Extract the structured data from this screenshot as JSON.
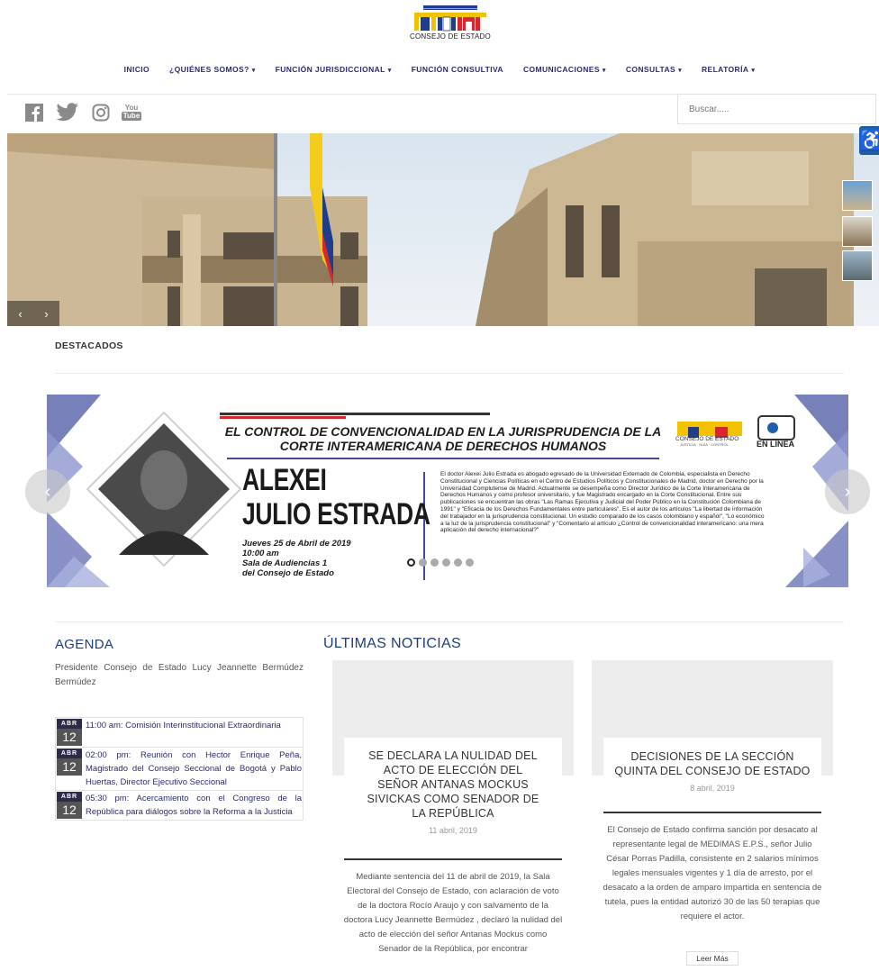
{
  "header": {
    "logo_text": "CONSEJO DE ESTADO",
    "nav": [
      {
        "label": "INICIO",
        "dropdown": false
      },
      {
        "label": "¿QUIÉNES SOMOS?",
        "dropdown": true
      },
      {
        "label": "FUNCIÓN JURISDICCIONAL",
        "dropdown": true
      },
      {
        "label": "FUNCIÓN CONSULTIVA",
        "dropdown": false
      },
      {
        "label": "COMUNICACIONES",
        "dropdown": true
      },
      {
        "label": "CONSULTAS",
        "dropdown": true
      },
      {
        "label": "RELATORÍA",
        "dropdown": true
      }
    ],
    "search_placeholder": "Buscar.....",
    "social": [
      "facebook-icon",
      "twitter-icon",
      "instagram-icon",
      "youtube-icon"
    ],
    "youtube_text_top": "You",
    "youtube_text_bottom": "Tube"
  },
  "hero": {
    "prev": "‹",
    "next": "›"
  },
  "destacados": {
    "heading": "DESTACADOS",
    "banner": {
      "title_line1": "EL CONTROL DE CONVENCIONALIDAD EN LA JURISPRUDENCIA DE LA",
      "title_line2": "CORTE INTERAMERICANA DE DERECHOS HUMANOS",
      "name_line1": "ALEXEI",
      "name_line2": "JULIO ESTRADA",
      "date": "Jueves 25 de Abril de 2019",
      "time": "10:00 am",
      "place1": "Sala de Audiencias 1",
      "place2": "del Consejo de Estado",
      "logo_caption": "CONSEJO DE ESTADO",
      "logo_sub": "JUSTICIA · GUÍA · CONTROL",
      "online": "EN LÍNEA",
      "bio": "El doctor Alexei Julio Estrada es abogado egresado de la Universidad Externado de Colombia, especialista en Derecho Constitucional y Ciencias Políticas en el Centro de Estudios Políticos y Constitucionales de Madrid, doctor en Derecho por la Universidad Complutense de Madrid. Actualmente se desempeña como Director Jurídico de la Corte Interamericana de Derechos Humanos y como profesor universitario, y fue Magistrado encargado en la Corte Constitucional. Entre sus publicaciones se encuentran las obras \"Las Ramas Ejecutiva y Judicial del Poder Público en la Constitución Colombiana de 1991\" y \"Eficacia de los Derechos Fundamentales entre particulares\". Es el autor de los artículos \"La libertad de información del trabajador en la jurisprudencia constitucional. Un estudio comparado de los casos colombiano y español\", \"Lo económico a la luz de la jurisprudencia constitucional\" y \"Comentario al artículo ¿Control de convencionalidad interamericano: una mera aplicación del derecho internacional?\""
    },
    "dots_count": 6,
    "active_dot": 0
  },
  "agenda": {
    "title": "AGENDA",
    "president": "Presidente Consejo de Estado Lucy Jeannette Bermúdez Bermúdez",
    "events": [
      {
        "month": "ABR",
        "day": "12",
        "text": "11:00 am: Comisión Interinstitucional Extraordinaria"
      },
      {
        "month": "ABR",
        "day": "12",
        "text": "02:00 pm: Reunión con Hector Enrique Peña, Magistrado del Consejo Seccional de Bogotá y Pablo Huertas, Director Ejecutivo Seccional"
      },
      {
        "month": "ABR",
        "day": "12",
        "text": "05:30 pm: Acercamiento con el Congreso de la República para diálogos sobre la Reforma a la Justicia"
      }
    ]
  },
  "news": {
    "title": "ÚLTIMAS NOTICIAS",
    "items": [
      {
        "title": "SE DECLARA LA NULIDAD DEL ACTO DE ELECCIÓN DEL SEÑOR ANTANAS MOCKUS SIVICKAS COMO SENADOR DE LA REPÚBLICA",
        "date": "11 abril, 2019",
        "text": "Mediante sentencia del 11 de abril de 2019, la Sala Electoral del Consejo de Estado, con aclaración de voto de la doctora Rocío Araujo y con salvamento de la doctora Lucy Jeannette Bermúdez , declaró la nulidad del acto de elección del señor Antanas Mockus como Senador de la República, por encontrar"
      },
      {
        "title": "DECISIONES DE LA SECCIÓN QUINTA DEL CONSEJO DE ESTADO",
        "date": "8 abril, 2019",
        "text": "El Consejo de Estado confirma sanción por desacato al representante legal de MEDIMAS E.P.S., señor Julio César Porras Padilla, consistente en 2 salarios mínimos legales mensuales vigentes y 1 día de arresto, por el desacato a la orden de amparo impartida en sentencia de tutela, pues la entidad autorizó 30 de las 50 terapias que requiere el actor.",
        "read_more": "Leer Más"
      }
    ]
  },
  "colors": {
    "nav_text": "#2a2a6e",
    "section_title": "#1e3e7a",
    "accessibility": "#1f5ea8"
  }
}
